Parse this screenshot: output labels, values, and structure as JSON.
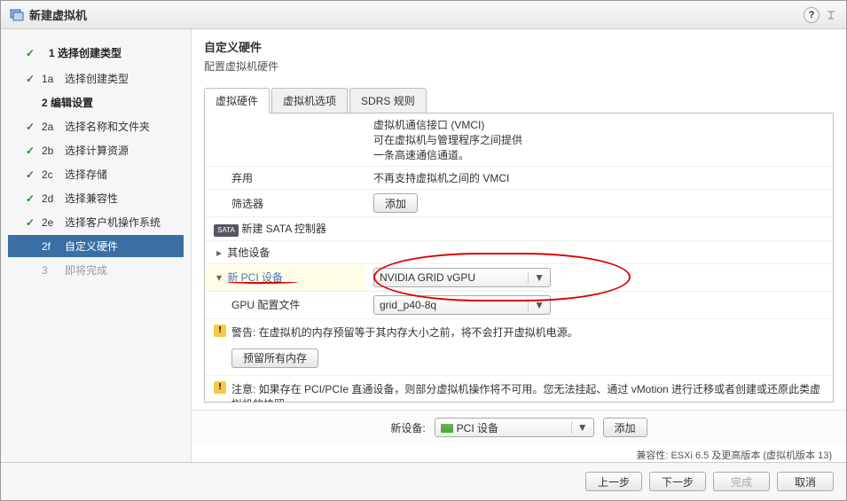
{
  "title": "新建虚拟机",
  "sidebar": {
    "major1": "1 选择创建类型",
    "s1a_num": "1a",
    "s1a": "选择创建类型",
    "major2": "2 编辑设置",
    "s2a_num": "2a",
    "s2a": "选择名称和文件夹",
    "s2b_num": "2b",
    "s2b": "选择计算资源",
    "s2c_num": "2c",
    "s2c": "选择存储",
    "s2d_num": "2d",
    "s2d": "选择兼容性",
    "s2e_num": "2e",
    "s2e": "选择客户机操作系统",
    "s2f_num": "2f",
    "s2f": "自定义硬件",
    "s3_num": "3",
    "s3": "即将完成"
  },
  "main": {
    "title": "自定义硬件",
    "subtitle": "配置虚拟机硬件",
    "tabs": {
      "hw": "虚拟硬件",
      "opts": "虚拟机选项",
      "sdrs": "SDRS 规则"
    },
    "vmci": {
      "title": "虚拟机通信接口 (VMCI)",
      "desc1": "可在虚拟机与管理程序之间提供",
      "desc2": "一条高速通信通道。",
      "deprecated_label": "弃用",
      "deprecated_text": "不再支持虚拟机之间的 VMCI",
      "filter_label": "筛选器",
      "add_btn": "添加"
    },
    "sata": {
      "badge": "SATA",
      "label": "新建 SATA 控制器"
    },
    "other": {
      "label": "其他设备"
    },
    "pci": {
      "label": "新 PCI 设备",
      "device_select": "NVIDIA GRID vGPU",
      "profile_label": "GPU 配置文件",
      "profile_select": "grid_p40-8q"
    },
    "warn1": "警告: 在虚拟机的内存预留等于其内存大小之前，将不会打开虚拟机电源。",
    "reserve_btn": "预留所有内存",
    "warn2": "注意: 如果存在 PCI/PCIe 直通设备，则部分虚拟机操作将不可用。您无法挂起、通过 vMotion 进行迁移或者创建或还原此类虚拟机的快照。",
    "newdev_label": "新设备:",
    "newdev_select": "PCI 设备",
    "newdev_add": "添加",
    "compat": "兼容性: ESXi 6.5 及更高版本 (虚拟机版本 13)"
  },
  "footer": {
    "back": "上一步",
    "next": "下一步",
    "finish": "完成",
    "cancel": "取消"
  }
}
